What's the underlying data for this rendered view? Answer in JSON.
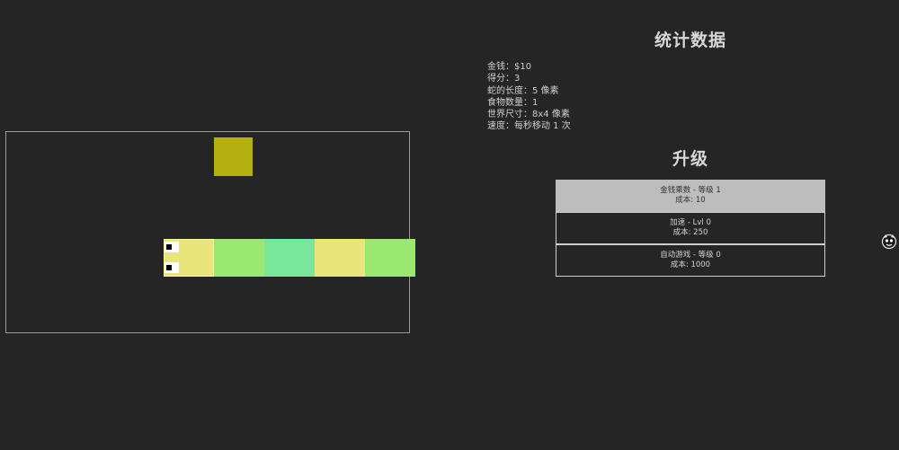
{
  "stats": {
    "title": "统计数据",
    "lines": [
      {
        "label": "金钱",
        "value": "$10"
      },
      {
        "label": "得分",
        "value": "3"
      },
      {
        "label": "蛇的长度",
        "value": "5 像素"
      },
      {
        "label": "食物数量",
        "value": "1"
      },
      {
        "label": "世界尺寸",
        "value": "8x4 像素"
      },
      {
        "label": "速度",
        "value": "每秒移动 1 次"
      }
    ],
    "separator": "："
  },
  "upgrades": {
    "title": "升级",
    "items": [
      {
        "name": "金钱乘数 - 等级 1",
        "cost": "成本: 10",
        "active": true
      },
      {
        "name": "加速 - Lvl 0",
        "cost": "成本: 250",
        "active": false
      },
      {
        "name": "自动游戏 - 等级 0",
        "cost": "成本: 1000",
        "active": false
      }
    ]
  },
  "game": {
    "grid": {
      "cols": 8,
      "rows": 4
    },
    "food": {
      "col": 4,
      "row": 0,
      "color": "#b3b010"
    },
    "snake": {
      "direction": "left",
      "segments": [
        {
          "col": 3,
          "row": 2,
          "color": "#e8e67a"
        },
        {
          "col": 4,
          "row": 2,
          "color": "#9be870"
        },
        {
          "col": 5,
          "row": 2,
          "color": "#77e89a"
        },
        {
          "col": 6,
          "row": 2,
          "color": "#e8e67a"
        },
        {
          "col": 7,
          "row": 2,
          "color": "#9be870"
        }
      ]
    }
  },
  "icons": {
    "side": "mascot-icon"
  }
}
